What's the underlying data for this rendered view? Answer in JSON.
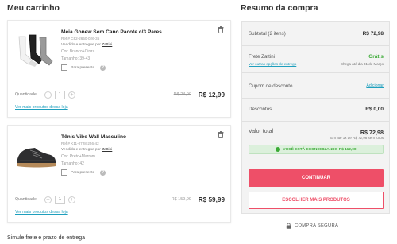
{
  "cart": {
    "title": "Meu carrinho",
    "items": [
      {
        "name": "Meia Gonew Sem Cano Pacote c/3 Pares",
        "ref": "Ref.# C62-2650-026-35",
        "seller_prefix": "Vendido e entregue por",
        "seller": "Zattini",
        "color": "Cor: Branco+Cinza",
        "size": "Tamanho: 39-43",
        "gift_label": "Para presente",
        "qty_label": "Quantidade:",
        "qty": "1",
        "price_old": "R$ 24,90",
        "price_new": "R$ 12,99",
        "more_link": "Ver mais produtos dessa loja",
        "image_icon": "socks-image"
      },
      {
        "name": "Tênis Vibe Wall Masculino",
        "ref": "Ref.# K11-0728-256-42",
        "seller_prefix": "Vendido e entregue por",
        "seller": "Zattini",
        "color": "Cor: Preto+Marrom",
        "size": "Tamanho: 42",
        "gift_label": "Para presente",
        "qty_label": "Quantidade:",
        "qty": "1",
        "price_old": "R$ 159,99",
        "price_new": "R$ 59,99",
        "more_link": "Ver mais produtos dessa loja",
        "image_icon": "sneaker-image"
      }
    ],
    "shipping_title": "Simule frete e prazo de entrega"
  },
  "summary": {
    "title": "Resumo da compra",
    "subtotal_label": "Subtotal (2 itens)",
    "subtotal_value": "R$ 72,98",
    "shipping_label": "Frete Zattini",
    "shipping_value": "Grátis",
    "shipping_options_link": "Ver outras opções de entrega",
    "shipping_eta": "Chega até dia 31 de Março",
    "coupon_label": "Cupom de desconto",
    "coupon_link": "Adicionar",
    "discounts_label": "Descontos",
    "discounts_value": "R$ 0,00",
    "total_label": "Valor total",
    "total_value": "R$ 72,98",
    "installments": "Em até 1x de R$ 72,98 sem juros",
    "savings": "VOCÊ ESTÁ ECONOMIZANDO R$ 112,00",
    "continue_button": "CONTINUAR",
    "more_products_button": "ESCOLHER MAIS PRODUTOS",
    "secure_label": "COMPRA SEGURA"
  },
  "colors": {
    "accent": "#ee4f68",
    "link": "#1e9fbd",
    "success": "#3aaa35"
  }
}
